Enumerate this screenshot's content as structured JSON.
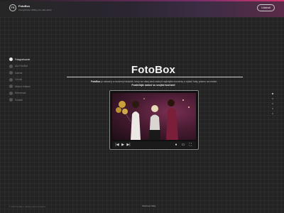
{
  "header": {
    "logo_text": "FB",
    "brand_name": "FotoBox",
    "brand_tagline": "Fotografické zážitky pre vašu akciu",
    "button_label": "Udalosti"
  },
  "sidebar": {
    "items": [
      {
        "label": "Fotografovanie",
        "active": true
      },
      {
        "label": "Ako FotoBox"
      },
      {
        "label": "Galéria"
      },
      {
        "label": "Cenník"
      },
      {
        "label": "Akcia s fotkami"
      },
      {
        "label": "Referencie"
      },
      {
        "label": "Kontakt"
      }
    ]
  },
  "main": {
    "title": "FotoBox",
    "description_prefix": "FotoBox",
    "description": " je zábavný a moderný fotokútik, ktorý na vašej akcii zachytí najkrajšie momenty a vytlačí fotky priamo na mieste.",
    "cta": "Pozdieľajte radosť so svojimi hosťami!"
  },
  "player": {
    "controls": [
      "|◀",
      "▶",
      "▶|",
      "●",
      "▭",
      "⛶"
    ]
  },
  "footer": {
    "left": "© 2024 FotoBox, všetky práva vyhradené",
    "center": "Sledovať ďalej"
  },
  "pagination": {
    "count": 5,
    "active": 0
  }
}
